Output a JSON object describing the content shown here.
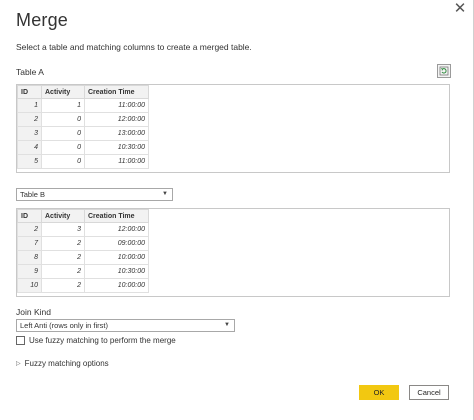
{
  "dialog": {
    "title": "Merge",
    "subtitle": "Select a table and matching columns to create a merged table.",
    "close_glyph": "✕"
  },
  "table_a": {
    "label": "Table A",
    "columns": [
      "ID",
      "Activity",
      "Creation Time"
    ],
    "rows": [
      [
        "1",
        "1",
        "11:00:00"
      ],
      [
        "2",
        "0",
        "12:00:00"
      ],
      [
        "3",
        "0",
        "13:00:00"
      ],
      [
        "4",
        "0",
        "10:30:00"
      ],
      [
        "5",
        "0",
        "11:00:00"
      ]
    ]
  },
  "table_b": {
    "selected": "Table B",
    "columns": [
      "ID",
      "Activity",
      "Creation Time"
    ],
    "rows": [
      [
        "2",
        "3",
        "12:00:00"
      ],
      [
        "7",
        "2",
        "09:00:00"
      ],
      [
        "8",
        "2",
        "10:00:00"
      ],
      [
        "9",
        "2",
        "10:30:00"
      ],
      [
        "10",
        "2",
        "10:00:00"
      ]
    ]
  },
  "join": {
    "label": "Join Kind",
    "selected": "Left Anti (rows only in first)"
  },
  "fuzzy": {
    "checkbox_label": "Use fuzzy matching to perform the merge",
    "checked": false,
    "options_label": "Fuzzy matching options"
  },
  "buttons": {
    "ok": "OK",
    "cancel": "Cancel"
  },
  "colors": {
    "ok_button": "#f2c811"
  }
}
